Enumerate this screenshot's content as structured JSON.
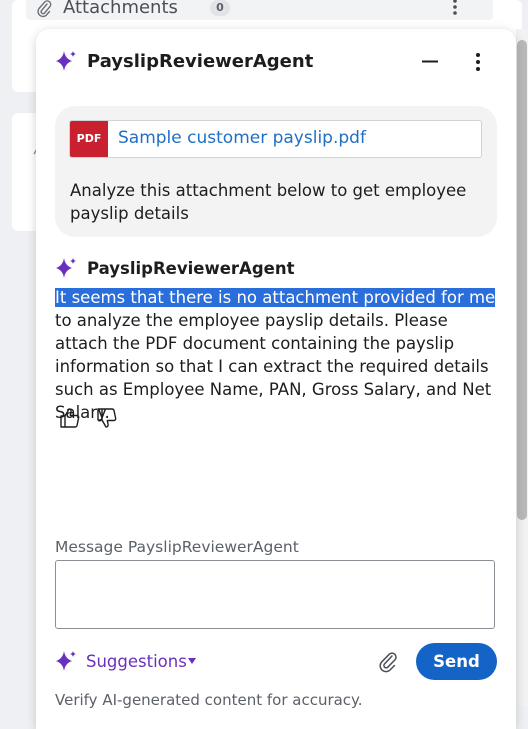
{
  "background": {
    "section_title": "Attachments",
    "attachment_count": "0"
  },
  "chat": {
    "agent_name": "PayslipReviewerAgent",
    "user_message": {
      "attachment_type": "PDF",
      "attachment_name": "Sample customer payslip.pdf",
      "text": "Analyze this attachment below to get employee payslip details"
    },
    "reply": {
      "agent_name": "PayslipReviewerAgent",
      "highlighted_text": "It seems that there is no attachment provided for me",
      "text": " to analyze the employee payslip details. Please attach the PDF document containing the payslip information so that I can extract the required details such as Employee Name, PAN, Gross Salary, and Net Salary."
    },
    "composer": {
      "label": "Message PayslipReviewerAgent",
      "value": "",
      "suggestions_label": "Suggestions",
      "send_label": "Send",
      "disclaimer": "Verify AI-generated content for accuracy."
    }
  },
  "colors": {
    "accent": "#1463c6",
    "sparkle": "#6b2fbf",
    "pdf_badge": "#c8202f",
    "link": "#1f6fc5",
    "selection": "#2a6edb"
  },
  "icons": [
    "paperclip-icon",
    "more-vertical-icon",
    "sparkle-icon",
    "minimize-icon",
    "thumbs-up-icon",
    "thumbs-down-icon",
    "caret-down-icon"
  ]
}
